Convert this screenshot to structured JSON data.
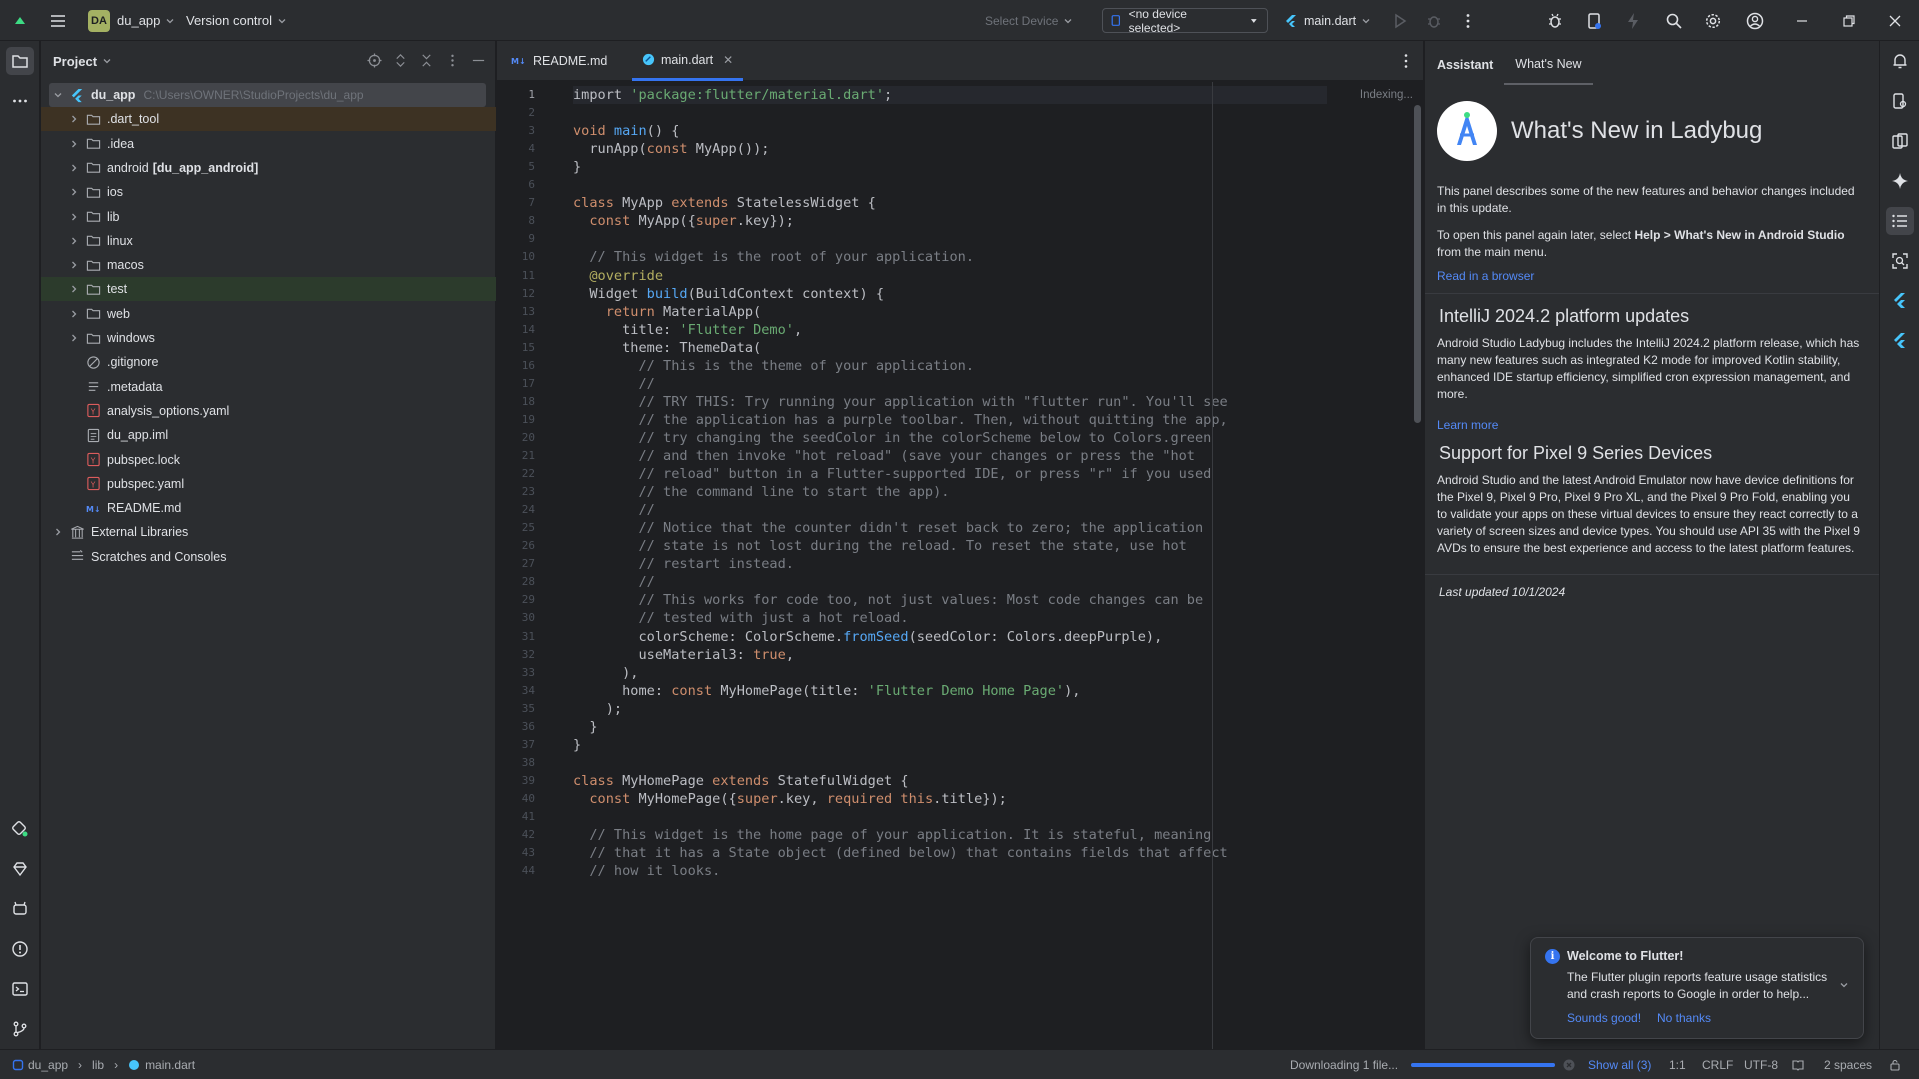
{
  "titlebar": {
    "project_badge": "DA",
    "project_name": "du_app",
    "vcs": "Version control",
    "select_device": "Select Device",
    "device": "<no device selected>",
    "run_config": "main.dart"
  },
  "project_panel": {
    "title": "Project",
    "tree": [
      {
        "label": "du_app",
        "path": "C:\\Users\\OWNER\\StudioProjects\\du_app",
        "icon": "flutter-icon"
      },
      {
        "label": ".dart_tool",
        "icon": "folder-icon"
      },
      {
        "label": ".idea",
        "icon": "folder-icon"
      },
      {
        "label": "android",
        "module": "[du_app_android]",
        "icon": "folder-icon"
      },
      {
        "label": "ios",
        "icon": "folder-icon"
      },
      {
        "label": "lib",
        "icon": "folder-icon"
      },
      {
        "label": "linux",
        "icon": "folder-icon"
      },
      {
        "label": "macos",
        "icon": "folder-icon"
      },
      {
        "label": "test",
        "icon": "folder-icon"
      },
      {
        "label": "web",
        "icon": "folder-icon"
      },
      {
        "label": "windows",
        "icon": "folder-icon"
      },
      {
        "label": ".gitignore",
        "icon": "ignore-file-icon"
      },
      {
        "label": ".metadata",
        "icon": "text-file-icon"
      },
      {
        "label": "analysis_options.yaml",
        "icon": "yaml-file-icon"
      },
      {
        "label": "du_app.iml",
        "icon": "iml-file-icon"
      },
      {
        "label": "pubspec.lock",
        "icon": "yaml-file-icon"
      },
      {
        "label": "pubspec.yaml",
        "icon": "yaml-file-icon"
      },
      {
        "label": "README.md",
        "icon": "markdown-file-icon"
      },
      {
        "label": "External Libraries",
        "icon": "library-icon"
      },
      {
        "label": "Scratches and Consoles",
        "icon": "scratches-icon"
      }
    ]
  },
  "editor": {
    "tabs": [
      {
        "label": "README.md",
        "icon": "markdown-file-icon"
      },
      {
        "label": "main.dart",
        "icon": "dart-file-icon"
      }
    ],
    "indexing": "Indexing...",
    "code": [
      [
        [
          "import ",
          "p"
        ],
        [
          "'package:flutter/material.dart'",
          "str"
        ],
        [
          ";",
          "p"
        ]
      ],
      [],
      [
        [
          "void ",
          "kw"
        ],
        [
          "main",
          "fn"
        ],
        [
          "() {",
          "p"
        ]
      ],
      [
        [
          "  runApp(",
          "p"
        ],
        [
          "const ",
          "kw"
        ],
        [
          "MyApp());",
          "p"
        ]
      ],
      [
        [
          "}",
          "p"
        ]
      ],
      [],
      [
        [
          "class ",
          "kw"
        ],
        [
          "MyApp ",
          "p"
        ],
        [
          "extends ",
          "kw"
        ],
        [
          "StatelessWidget {",
          "p"
        ]
      ],
      [
        [
          "  const ",
          "kw"
        ],
        [
          "MyApp({",
          "p"
        ],
        [
          "super",
          "kw"
        ],
        [
          ".key});",
          "p"
        ]
      ],
      [],
      [
        [
          "  // This widget is the root of your application.",
          "cmt"
        ]
      ],
      [
        [
          "  @override",
          "ann"
        ]
      ],
      [
        [
          "  Widget ",
          "p"
        ],
        [
          "build",
          "fn"
        ],
        [
          "(BuildContext context) {",
          "p"
        ]
      ],
      [
        [
          "    return ",
          "kw"
        ],
        [
          "MaterialApp(",
          "p"
        ]
      ],
      [
        [
          "      title: ",
          "p"
        ],
        [
          "'Flutter Demo'",
          "str"
        ],
        [
          ",",
          "p"
        ]
      ],
      [
        [
          "      theme: ThemeData(",
          "p"
        ]
      ],
      [
        [
          "        // This is the theme of your application.",
          "cmt"
        ]
      ],
      [
        [
          "        //",
          "cmt"
        ]
      ],
      [
        [
          "        // TRY THIS: Try running your application with \"flutter run\". You'll see",
          "cmt"
        ]
      ],
      [
        [
          "        // the application has a purple toolbar. Then, without quitting the app,",
          "cmt"
        ]
      ],
      [
        [
          "        // try changing the seedColor in the colorScheme below to Colors.green",
          "cmt"
        ]
      ],
      [
        [
          "        // and then invoke \"hot reload\" (save your changes or press the \"hot",
          "cmt"
        ]
      ],
      [
        [
          "        // reload\" button in a Flutter-supported IDE, or press \"r\" if you used",
          "cmt"
        ]
      ],
      [
        [
          "        // the command line to start the app).",
          "cmt"
        ]
      ],
      [
        [
          "        //",
          "cmt"
        ]
      ],
      [
        [
          "        // Notice that the counter didn't reset back to zero; the application",
          "cmt"
        ]
      ],
      [
        [
          "        // state is not lost during the reload. To reset the state, use hot",
          "cmt"
        ]
      ],
      [
        [
          "        // restart instead.",
          "cmt"
        ]
      ],
      [
        [
          "        //",
          "cmt"
        ]
      ],
      [
        [
          "        // This works for code too, not just values: Most code changes can be",
          "cmt"
        ]
      ],
      [
        [
          "        // tested with just a hot reload.",
          "cmt"
        ]
      ],
      [
        [
          "        colorScheme: ColorScheme.",
          "p"
        ],
        [
          "fromSeed",
          "fn"
        ],
        [
          "(seedColor: Colors.deepPurple),",
          "p"
        ]
      ],
      [
        [
          "        useMaterial3: ",
          "p"
        ],
        [
          "true",
          "kw"
        ],
        [
          ",",
          "p"
        ]
      ],
      [
        [
          "      ),",
          "p"
        ]
      ],
      [
        [
          "      home: ",
          "p"
        ],
        [
          "const ",
          "kw"
        ],
        [
          "MyHomePage(title: ",
          "p"
        ],
        [
          "'Flutter Demo Home Page'",
          "str"
        ],
        [
          "),",
          "p"
        ]
      ],
      [
        [
          "    );",
          "p"
        ]
      ],
      [
        [
          "  }",
          "p"
        ]
      ],
      [
        [
          "}",
          "p"
        ]
      ],
      [],
      [
        [
          "class ",
          "kw"
        ],
        [
          "MyHomePage ",
          "p"
        ],
        [
          "extends ",
          "kw"
        ],
        [
          "StatefulWidget {",
          "p"
        ]
      ],
      [
        [
          "  const ",
          "kw"
        ],
        [
          "MyHomePage({",
          "p"
        ],
        [
          "super",
          "kw"
        ],
        [
          ".key, ",
          "p"
        ],
        [
          "required ",
          "kw"
        ],
        [
          "this",
          "kw"
        ],
        [
          ".title});",
          "p"
        ]
      ],
      [],
      [
        [
          "  // This widget is the home page of your application. It is stateful, meaning",
          "cmt"
        ]
      ],
      [
        [
          "  // that it has a State object (defined below) that contains fields that affect",
          "cmt"
        ]
      ],
      [
        [
          "  // how it looks.",
          "cmt"
        ]
      ]
    ]
  },
  "assistant": {
    "tab_assistant": "Assistant",
    "tab_whats_new": "What's New",
    "title": "What's New in Ladybug",
    "intro": "This panel describes some of the new features and behavior changes included in this update.",
    "open_prefix": "To open this panel again later, select ",
    "open_help": "Help > What's New in Android Studio",
    "open_suffix": " from the main menu.",
    "read_browser": "Read in a browser",
    "s1_title": "IntelliJ 2024.2 platform updates",
    "s1_body": "Android Studio Ladybug includes the IntelliJ 2024.2 platform release, which has many new features such as integrated K2 mode for improved Kotlin stability, enhanced IDE startup efficiency, simplified cron expression management, and more.",
    "learn_more": "Learn more",
    "s2_title": "Support for Pixel 9 Series Devices",
    "s2_body": "Android Studio and the latest Android Emulator now have device definitions for the Pixel 9, Pixel 9 Pro, Pixel 9 Pro XL, and the Pixel 9 Pro Fold, enabling you to validate your apps on these virtual devices to ensure they react correctly to a variety of screen sizes and device types. You should use API 35 with the Pixel 9 AVDs to ensure the best experience and access to the latest platform features.",
    "updated": "Last updated 10/1/2024"
  },
  "notification": {
    "title": "Welcome to Flutter!",
    "body": "The Flutter plugin reports feature usage statistics and crash reports to Google in order to help...",
    "accept": "Sounds good!",
    "decline": "No thanks"
  },
  "statusbar": {
    "crumb_project": "du_app",
    "crumb_lib": "lib",
    "crumb_file": "main.dart",
    "download": "Downloading 1 file...",
    "download_progress": 1.0,
    "show_all": "Show all (3)",
    "position": "1:1",
    "line_sep": "CRLF",
    "encoding": "UTF-8",
    "indent": "2 spaces"
  },
  "colors": {
    "accent": "#3574f0",
    "link": "#548af7",
    "keyword": "#cf8e6d",
    "string": "#6aab73",
    "comment": "#7a7e85",
    "function": "#56a8f5",
    "flutter_blue": "#47c5fb"
  }
}
